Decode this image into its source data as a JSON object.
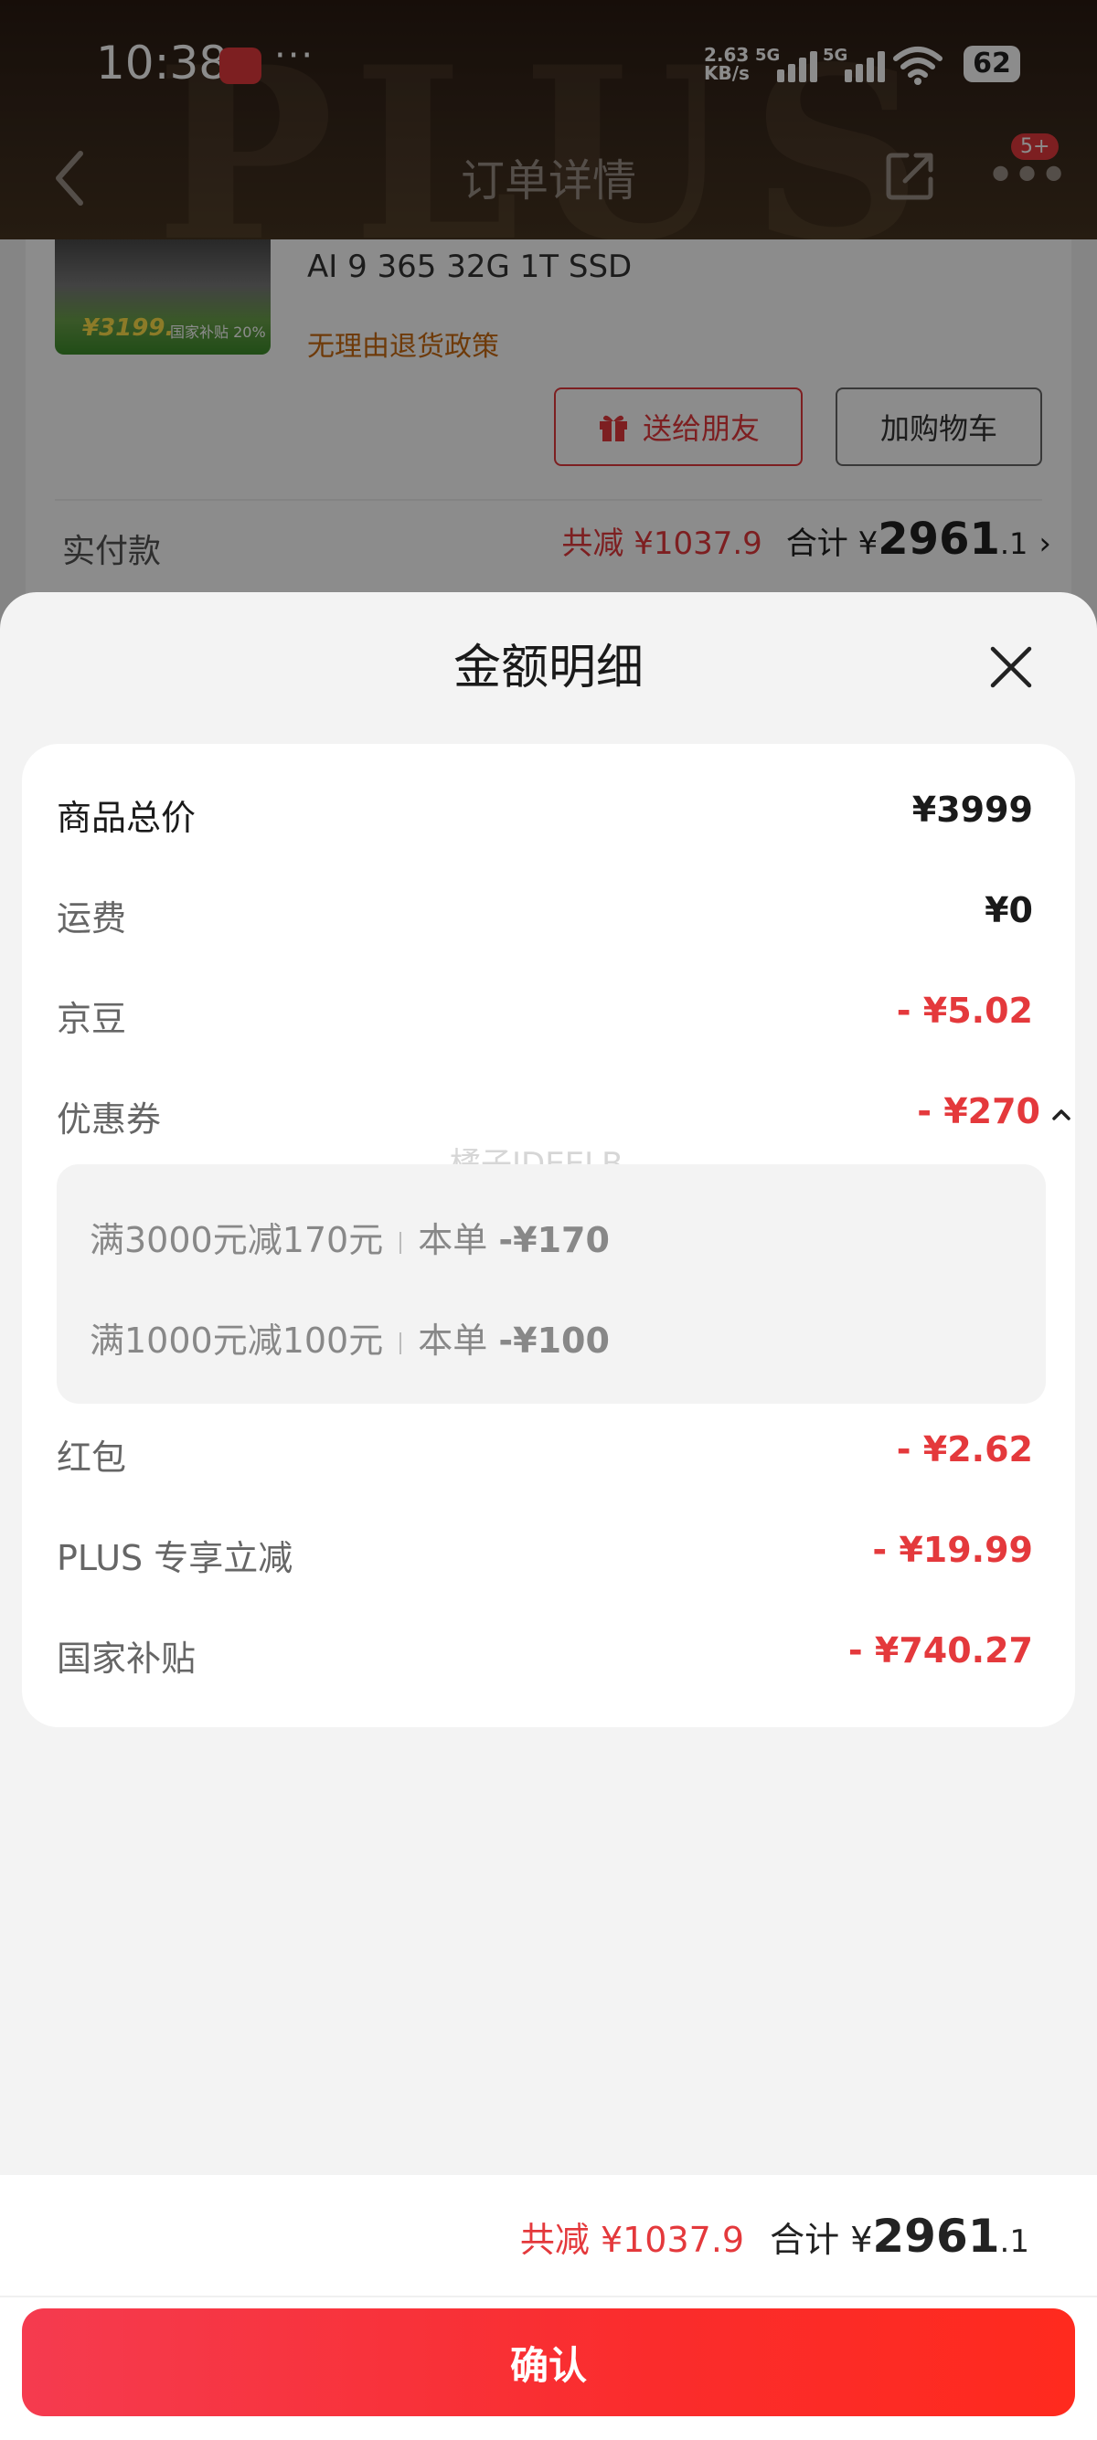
{
  "status_bar": {
    "time": "10:38",
    "more": "···",
    "net_speed_value": "2.63",
    "net_speed_unit": "KB/s",
    "net1": "5G",
    "net2": "5G",
    "battery": "62"
  },
  "nav": {
    "title": "订单详情",
    "badge": "5+"
  },
  "background_watermark": "PLUS",
  "product": {
    "thumb_price": "¥3199.",
    "thumb_tag": "国家补贴 20%",
    "spec": "AI 9 365 32G 1T SSD",
    "return_policy": "无理由退货政策",
    "gift_label": "送给朋友",
    "cart_label": "加购物车"
  },
  "payment": {
    "label": "实付款",
    "total_saved": "共减 ¥1037.9",
    "total_label": "合计 ¥",
    "total_big": "2961",
    "total_small": ".1"
  },
  "sheet": {
    "title": "金额明细",
    "watermark": "橘子IDEELB",
    "rows": [
      {
        "label": "商品总价",
        "value": "¥3999"
      },
      {
        "label": "运费",
        "value": "¥0"
      },
      {
        "label": "京豆",
        "value": "- ¥5.02"
      },
      {
        "label": "优惠券",
        "value": "- ¥270"
      },
      {
        "label": "红包",
        "value": "- ¥2.62"
      },
      {
        "label": "PLUS 专享立减",
        "value": "- ¥19.99"
      },
      {
        "label": "国家补贴",
        "value": "- ¥740.27"
      }
    ],
    "coupons": [
      {
        "rule": "满3000元减170元",
        "scope": "本单",
        "amount": "-¥170"
      },
      {
        "rule": "满1000元减100元",
        "scope": "本单",
        "amount": "-¥100"
      }
    ]
  },
  "footer": {
    "total_saved": "共减 ¥1037.9",
    "total_label": "合计 ¥",
    "total_big": "2961",
    "total_small": ".1",
    "confirm_label": "确认"
  },
  "colors": {
    "accent_red": "#e4393c",
    "return_policy": "#c96a12"
  }
}
